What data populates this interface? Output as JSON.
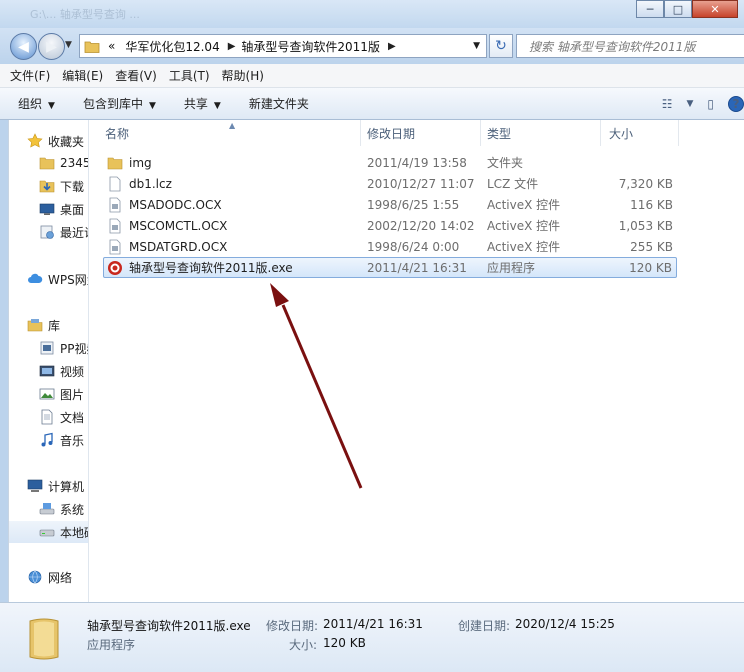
{
  "window": {
    "title_ghost": "G:\\... 轴承型号查询 ...",
    "minimize": "─",
    "maximize": "□",
    "close": "✕"
  },
  "address": {
    "prefix": "«",
    "crumbs": [
      "华军优化包12.04",
      "轴承型号查询软件2011版"
    ],
    "search_placeholder": "搜索 轴承型号查询软件2011版"
  },
  "menu": [
    "文件(F)",
    "编辑(E)",
    "查看(V)",
    "工具(T)",
    "帮助(H)"
  ],
  "toolbar": {
    "organize": "组织",
    "include_library": "包含到库中",
    "share": "共享",
    "new_folder": "新建文件夹"
  },
  "nav": {
    "items": [
      {
        "label": "收藏夹",
        "icon": "star-icon"
      },
      {
        "label": "2345",
        "icon": "folder-icon"
      },
      {
        "label": "下载",
        "icon": "download-folder-icon"
      },
      {
        "label": "桌面",
        "icon": "desktop-icon"
      },
      {
        "label": "最近访问的位置",
        "icon": "recent-places-icon"
      },
      {
        "label": "WPS网盘",
        "icon": "cloud-icon"
      },
      {
        "label": "库",
        "icon": "library-icon"
      },
      {
        "label": "PP视频",
        "icon": "video-library-icon"
      },
      {
        "label": "视频",
        "icon": "video-icon"
      },
      {
        "label": "图片",
        "icon": "picture-icon"
      },
      {
        "label": "文档",
        "icon": "document-icon"
      },
      {
        "label": "音乐",
        "icon": "music-icon"
      },
      {
        "label": "计算机",
        "icon": "computer-icon"
      },
      {
        "label": "系统 (C:)",
        "icon": "drive-system-icon"
      },
      {
        "label": "本地磁盘 (D:)",
        "icon": "drive-icon"
      },
      {
        "label": "网络",
        "icon": "network-icon"
      }
    ]
  },
  "columns": {
    "name": "名称",
    "date": "修改日期",
    "type": "类型",
    "size": "大小"
  },
  "files": [
    {
      "name": "img",
      "date": "2011/4/19 13:58",
      "type": "文件夹",
      "size": "",
      "icon": "folder-icon"
    },
    {
      "name": "db1.lcz",
      "date": "2010/12/27 11:07",
      "type": "LCZ 文件",
      "size": "7,320 KB",
      "icon": "file-icon"
    },
    {
      "name": "MSADODC.OCX",
      "date": "1998/6/25 1:55",
      "type": "ActiveX 控件",
      "size": "116 KB",
      "icon": "ocx-icon"
    },
    {
      "name": "MSCOMCTL.OCX",
      "date": "2002/12/20 14:02",
      "type": "ActiveX 控件",
      "size": "1,053 KB",
      "icon": "ocx-icon"
    },
    {
      "name": "MSDATGRD.OCX",
      "date": "1998/6/24 0:00",
      "type": "ActiveX 控件",
      "size": "255 KB",
      "icon": "ocx-icon"
    },
    {
      "name": "轴承型号查询软件2011版.exe",
      "date": "2011/4/21 16:31",
      "type": "应用程序",
      "size": "120 KB",
      "icon": "exe-icon"
    }
  ],
  "details": {
    "name": "轴承型号查询软件2011版.exe",
    "type": "应用程序",
    "modified_label": "修改日期:",
    "modified_value": "2011/4/21 16:31",
    "created_label": "创建日期:",
    "created_value": "2020/12/4 15:25",
    "size_label": "大小:",
    "size_value": "120 KB"
  },
  "colors": {
    "arrow": "#7a1010",
    "selection": "#d4e6fa",
    "accent": "#2a66b8"
  }
}
